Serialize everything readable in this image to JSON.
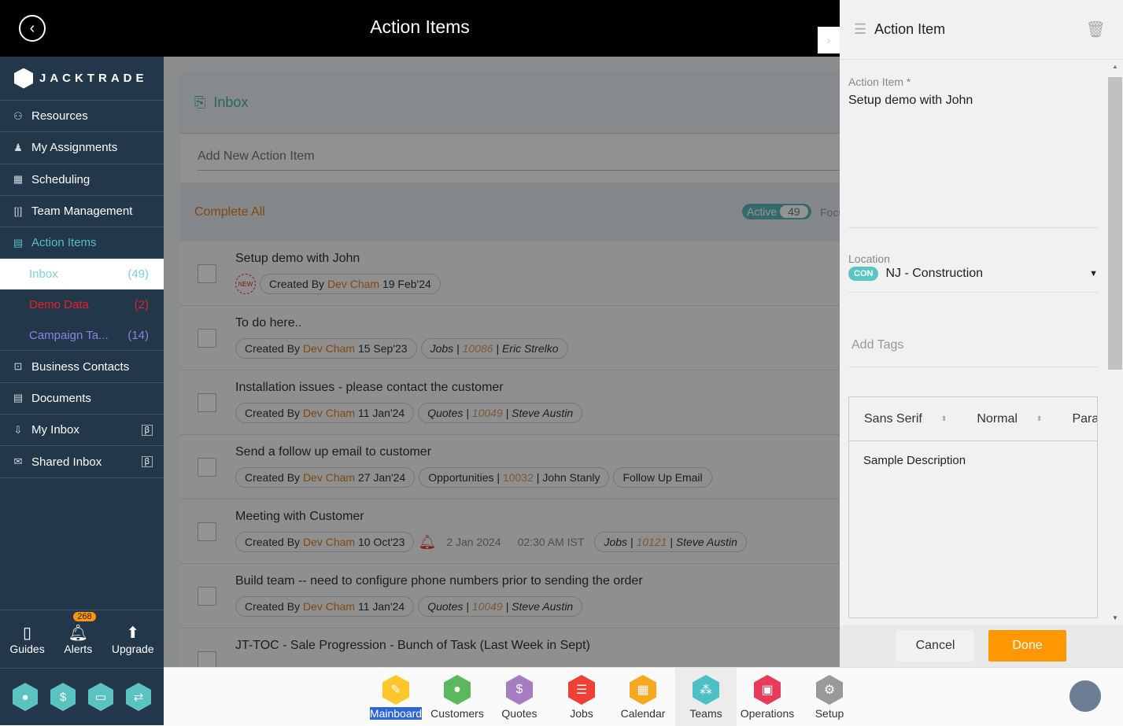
{
  "header": {
    "title": "Action Items",
    "back_icon": "back-arrow-icon"
  },
  "sidebar": {
    "logo": "JACKTRADE",
    "items": [
      {
        "label": "Resources",
        "icon": "resources-icon"
      },
      {
        "label": "My Assignments",
        "icon": "assignments-icon"
      },
      {
        "label": "Scheduling",
        "icon": "scheduling-icon"
      },
      {
        "label": "Team Management",
        "icon": "team-management-icon"
      },
      {
        "label": "Action Items",
        "icon": "clipboard-icon"
      }
    ],
    "sub": [
      {
        "label": "Inbox",
        "count": "(49)"
      },
      {
        "label": "Demo Data",
        "count": "(2)",
        "color": "#e8202a"
      },
      {
        "label": "Campaign Ta...",
        "count": "(14)",
        "color": "#8a84e0"
      }
    ],
    "items2": [
      {
        "label": "Business Contacts",
        "icon": "contacts-icon"
      },
      {
        "label": "Documents",
        "icon": "documents-icon"
      },
      {
        "label": "My Inbox",
        "icon": "inbox-icon",
        "beta": "β"
      },
      {
        "label": "Shared Inbox",
        "icon": "mail-icon",
        "beta": "β"
      }
    ],
    "utils": {
      "guides": "Guides",
      "alerts": "Alerts",
      "alerts_count": "268",
      "upgrade": "Upgrade"
    }
  },
  "main": {
    "inbox_title": "Inbox",
    "add_placeholder": "Add New Action Item",
    "complete_all": "Complete All",
    "active_label": "Active",
    "active_count": "49",
    "focus_label": "Focu",
    "rows": [
      {
        "title": "Setup demo with John",
        "date": "19 Feb'24"
      },
      {
        "title": "To do here..",
        "date": "15 Sep'23",
        "link": {
          "type": "Jobs",
          "id": "10086",
          "name": "Eric Strelko"
        }
      },
      {
        "title": "Installation issues - please contact the customer",
        "date": "11 Jan'24",
        "link": {
          "type": "Quotes",
          "id": "10049",
          "name": "Steve Austin"
        }
      },
      {
        "title": "Send a follow up email to customer",
        "date": "27 Jan'24",
        "link": {
          "type": "Opportunities",
          "id": "10032",
          "name": "John Stanly"
        },
        "tag": "Follow Up Email"
      },
      {
        "title": "Meeting with Customer",
        "date": "10 Oct'23",
        "reminder_date": "2 Jan 2024",
        "reminder_time": "02:30 AM IST",
        "link": {
          "type": "Jobs",
          "id": "10121",
          "name": "Steve Austin"
        }
      },
      {
        "title": "Build team -- need to configure phone numbers prior to sending the order",
        "date": "11 Jan'24",
        "link": {
          "type": "Quotes",
          "id": "10049",
          "name": "Steve Austin"
        }
      },
      {
        "title": "JT-TOC - Sale Progression - Bunch of Task (Last Week in Sept)"
      }
    ],
    "created_by": "Created By",
    "creator": "Dev Cham",
    "new_label": "NEW"
  },
  "drawer": {
    "title": "Action Item",
    "action_label": "Action Item *",
    "action_value": "Setup demo with John",
    "location_label": "Location",
    "location_code": "CON",
    "location_value": "NJ - Construction",
    "tags_placeholder": "Add Tags",
    "font": "Sans Serif",
    "size": "Normal",
    "format": "Parag",
    "description": "Sample Description",
    "cancel": "Cancel",
    "done": "Done"
  },
  "bottom_nav": [
    {
      "label": "Mainboard",
      "color": "#ffc72c",
      "glyph": "✎"
    },
    {
      "label": "Customers",
      "color": "#5cb85c",
      "glyph": "●"
    },
    {
      "label": "Quotes",
      "color": "#a77dc2",
      "glyph": "$"
    },
    {
      "label": "Jobs",
      "color": "#ef4036",
      "glyph": "☰"
    },
    {
      "label": "Calendar",
      "color": "#f6a821",
      "glyph": "▦"
    },
    {
      "label": "Teams",
      "color": "#4dc0c4",
      "glyph": "⁂"
    },
    {
      "label": "Operations",
      "color": "#e83a5a",
      "glyph": "▣"
    },
    {
      "label": "Setup",
      "color": "#999999",
      "glyph": "⚙"
    }
  ]
}
